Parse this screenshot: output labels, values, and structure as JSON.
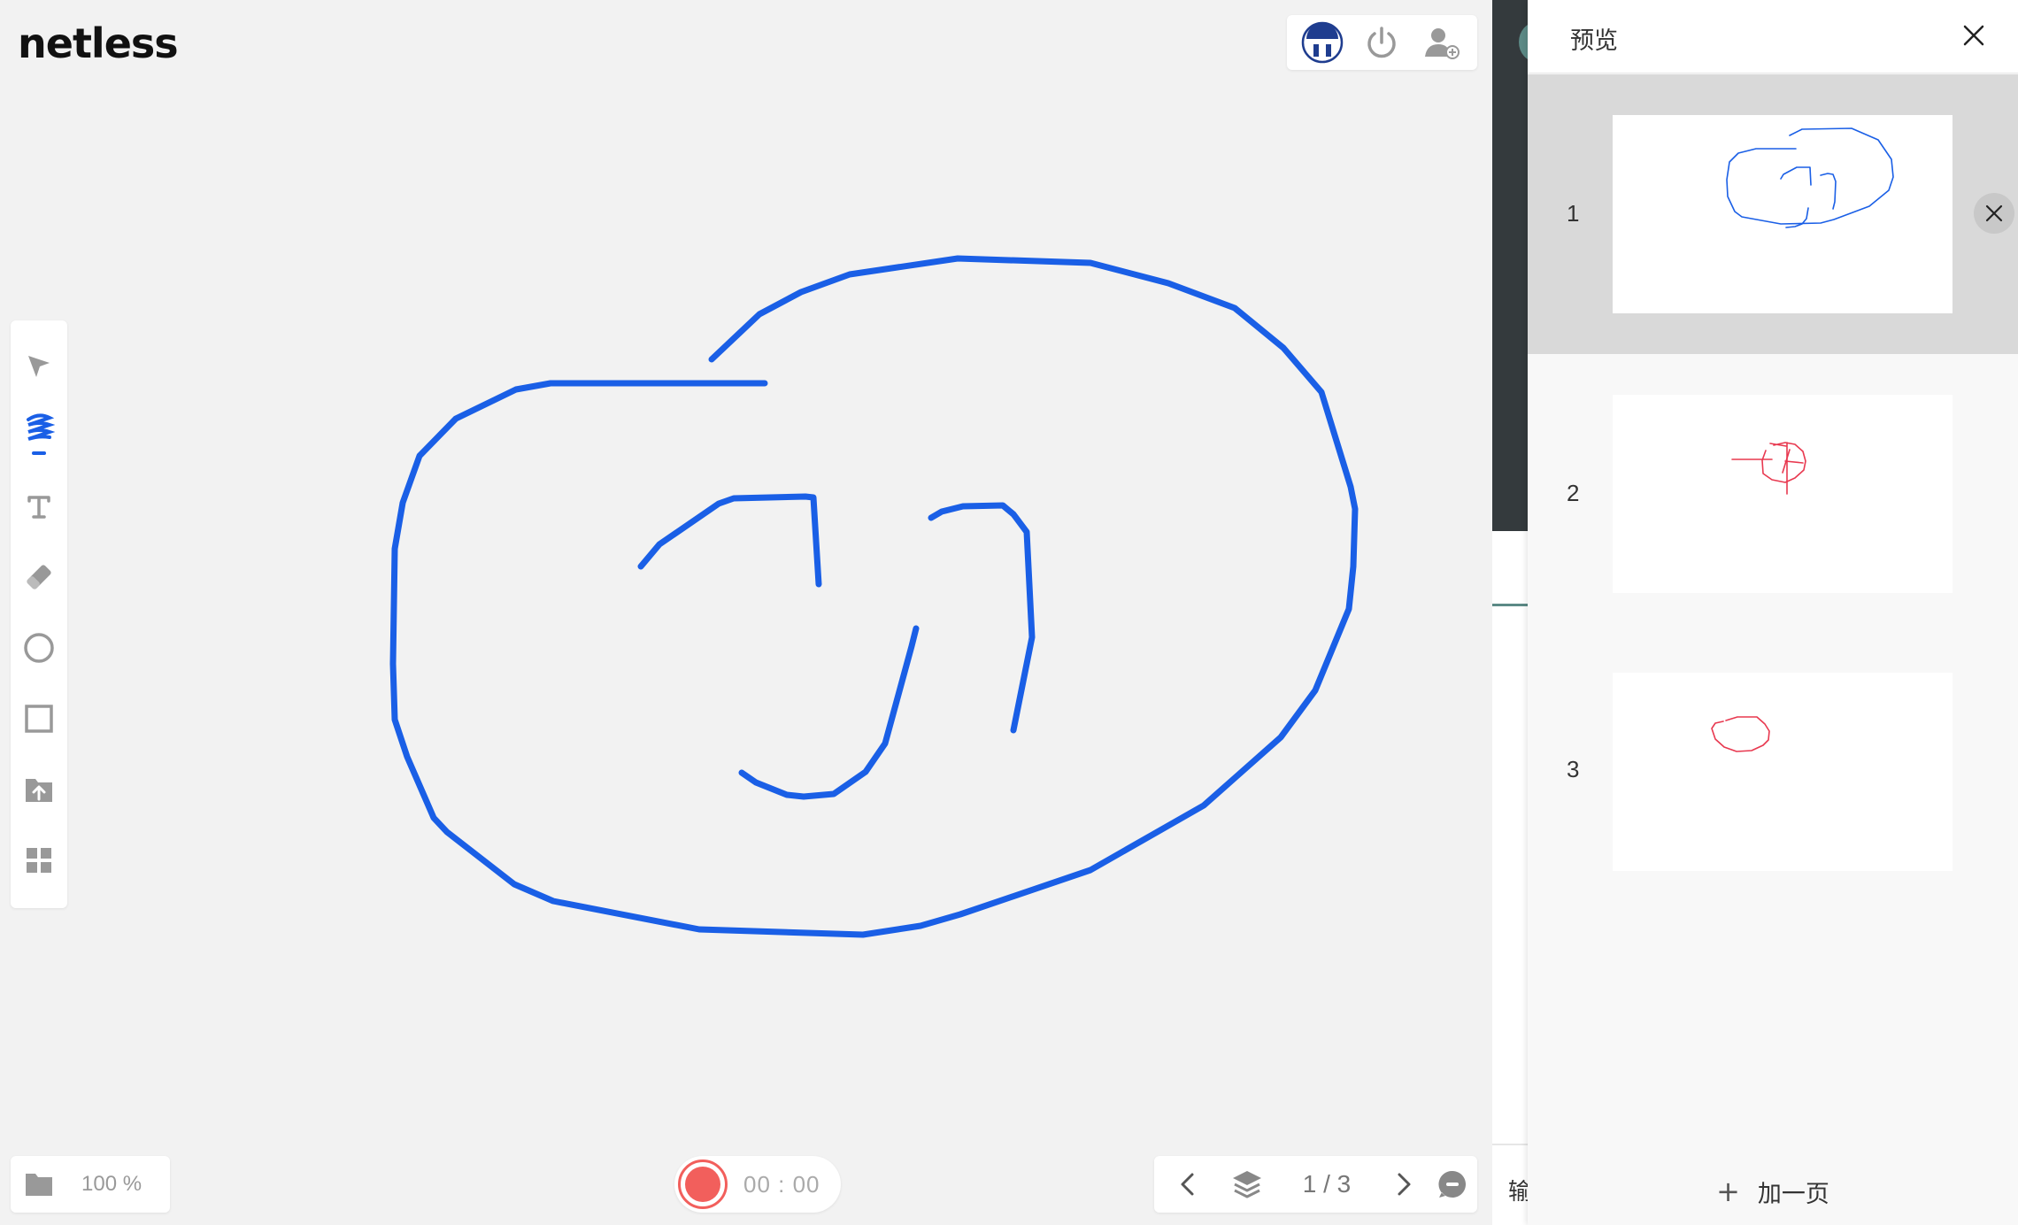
{
  "app": {
    "logo": "netless"
  },
  "topbar": {
    "avatar": "avatar",
    "power_icon": "power-icon",
    "add_user_icon": "add-user-icon"
  },
  "tools": [
    {
      "name": "selector",
      "icon": "cursor-arrow-icon"
    },
    {
      "name": "pencil",
      "icon": "pencil-icon",
      "active": true
    },
    {
      "name": "text",
      "icon": "text-icon"
    },
    {
      "name": "eraser",
      "icon": "eraser-icon"
    },
    {
      "name": "ellipse",
      "icon": "circle-icon"
    },
    {
      "name": "rectangle",
      "icon": "square-icon"
    },
    {
      "name": "upload",
      "icon": "upload-folder-icon"
    },
    {
      "name": "more",
      "icon": "grid-icon"
    }
  ],
  "zoom": {
    "value": "100 %"
  },
  "record": {
    "time": "00 : 00"
  },
  "pager": {
    "current": "1 / 3"
  },
  "preview": {
    "title": "预览",
    "pages": [
      {
        "number": "1"
      },
      {
        "number": "2"
      },
      {
        "number": "3"
      }
    ],
    "add_page": "加一页"
  },
  "partial": {
    "cut_char": "输"
  },
  "colors": {
    "stroke_blue": "#1a5fe6",
    "stroke_red": "#e8384f",
    "record_red": "#f25f5c",
    "dark_strip": "#343a3d",
    "teal": "#5c8a86"
  }
}
